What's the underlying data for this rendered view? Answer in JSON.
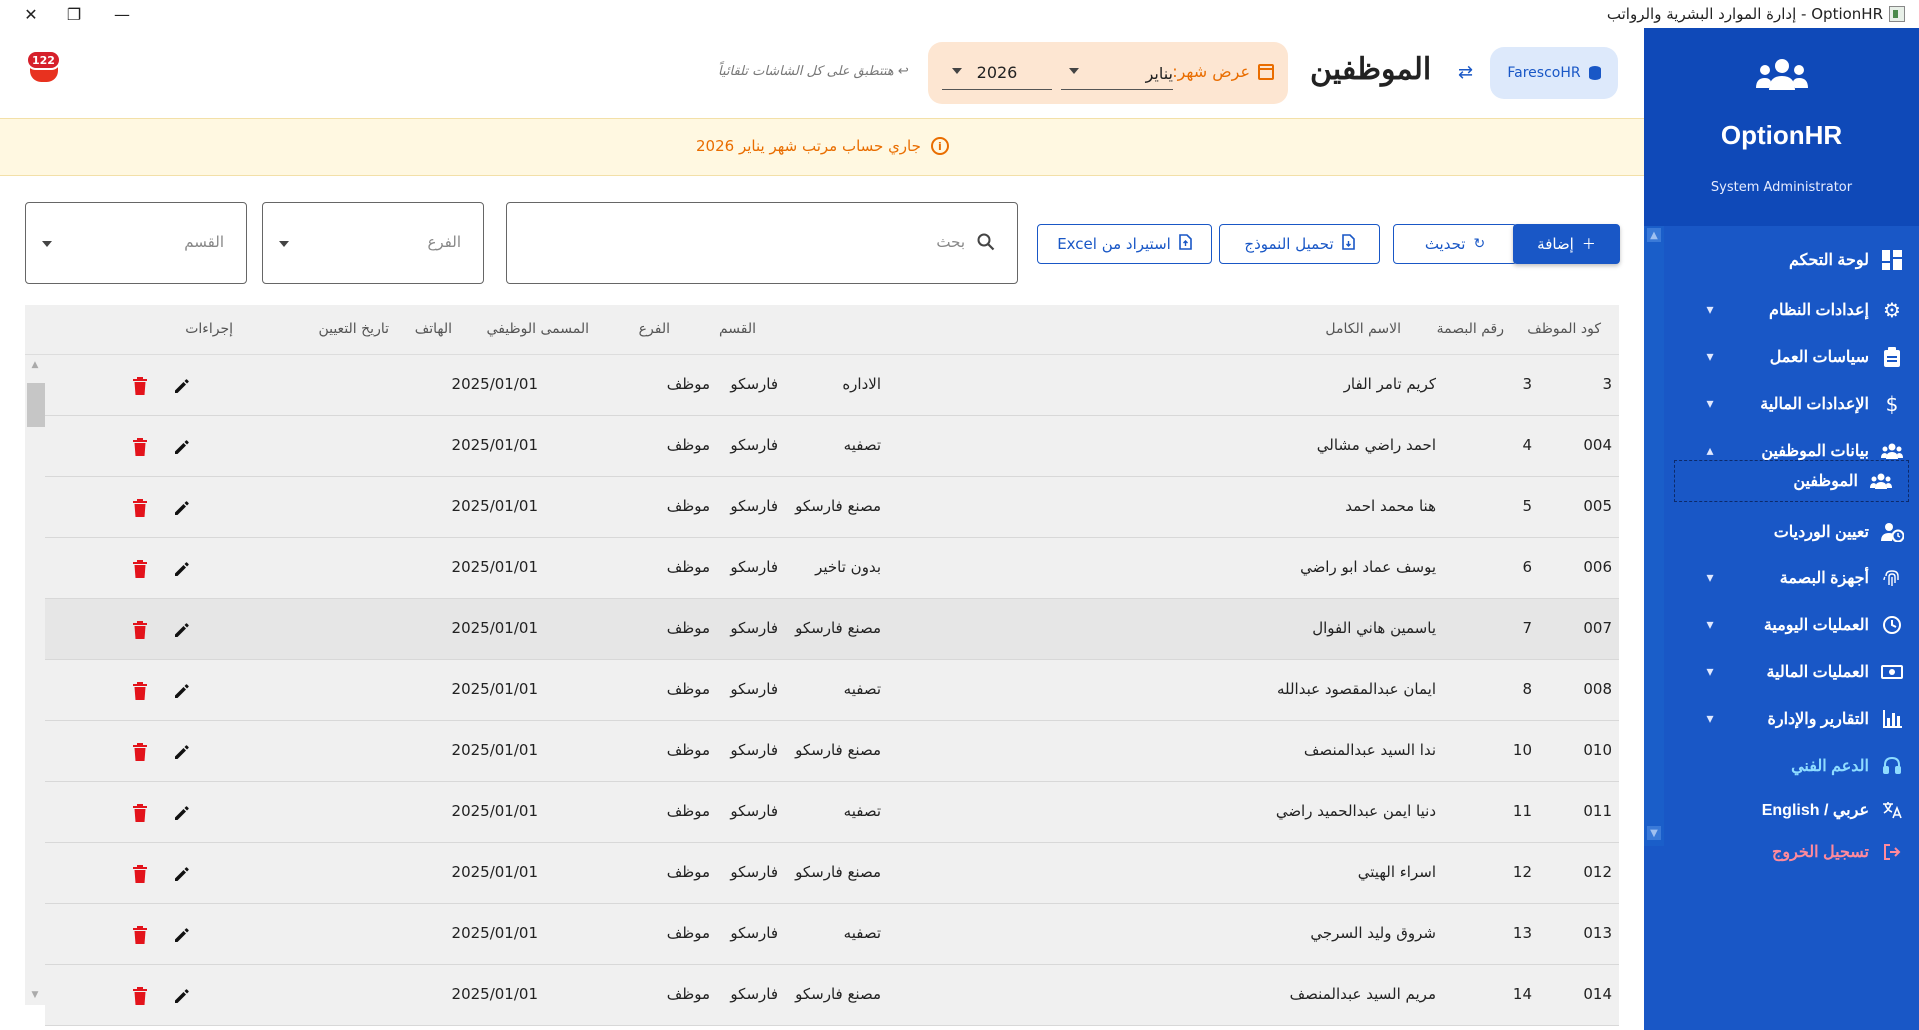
{
  "window": {
    "title": "OptionHR - إدارة الموارد البشرية والرواتب"
  },
  "sidebar": {
    "app_name": "OptionHR",
    "role": "System Administrator",
    "items": [
      {
        "label": "لوحة التحكم",
        "icon": "dashboard-icon"
      },
      {
        "label": "إعدادات النظام",
        "icon": "gear-icon"
      },
      {
        "label": "سياسات العمل",
        "icon": "clipboard-icon"
      },
      {
        "label": "الإعدادات المالية",
        "icon": "dollar-icon"
      },
      {
        "label": "بيانات الموظفين",
        "icon": "users-icon"
      },
      {
        "label": "الموظفين",
        "icon": "users-icon"
      },
      {
        "label": "تعيين الورديات",
        "icon": "user-clock-icon"
      },
      {
        "label": "أجهزة البصمة",
        "icon": "fingerprint-icon"
      },
      {
        "label": "العمليات اليومية",
        "icon": "clock-icon"
      },
      {
        "label": "العمليات المالية",
        "icon": "money-icon"
      },
      {
        "label": "التقارير والإدارة",
        "icon": "bar-chart-icon"
      },
      {
        "label": "الدعم الفني",
        "icon": "headset-icon"
      },
      {
        "label": "عربي / English",
        "icon": "translate-icon"
      },
      {
        "label": "تسجيل الخروج",
        "icon": "logout-icon"
      }
    ]
  },
  "header": {
    "notifications_count": "122",
    "hint": "↩ هتتطبق على كل الشاشات تلقائياً",
    "month_label": "عرض شهر:",
    "month_value": "يناير",
    "year_value": "2026",
    "page_title": "الموظفين",
    "database": "FarescoHR"
  },
  "banner": {
    "text": "جاري حساب مرتب شهر يناير 2026"
  },
  "filters": {
    "search_placeholder": "بحث",
    "branch_placeholder": "الفرع",
    "department_placeholder": "القسم"
  },
  "toolbar": {
    "add_label": "إضافة",
    "refresh_label": "تحديث",
    "template_label": "تحميل النموذج",
    "import_label": "استيراد من Excel"
  },
  "table": {
    "headers": {
      "code": "كود الموظف",
      "fingerprint": "رقم البصمة",
      "name": "الاسم الكامل",
      "department": "القسم",
      "branch": "الفرع",
      "job_title": "المسمى الوظيفي",
      "phone": "الهاتف",
      "hire_date": "تاريخ التعيين",
      "actions": "إجراءات"
    },
    "rows": [
      {
        "code": "3",
        "fingerprint": "3",
        "name": "كريم تامر الفار",
        "department": "الاداره",
        "branch": "فارسكو",
        "job_title": "موظف",
        "phone": "",
        "hire_date": "2025/01/01"
      },
      {
        "code": "004",
        "fingerprint": "4",
        "name": "احمد راضي مشالي",
        "department": "تصفيه",
        "branch": "فارسكو",
        "job_title": "موظف",
        "phone": "",
        "hire_date": "2025/01/01"
      },
      {
        "code": "005",
        "fingerprint": "5",
        "name": "هنا محمد احمد",
        "department": "مصنع فارسكو",
        "branch": "فارسكو",
        "job_title": "موظف",
        "phone": "",
        "hire_date": "2025/01/01"
      },
      {
        "code": "006",
        "fingerprint": "6",
        "name": "يوسف عماد ابو راضي",
        "department": "بدون تاخير",
        "branch": "فارسكو",
        "job_title": "موظف",
        "phone": "",
        "hire_date": "2025/01/01"
      },
      {
        "code": "007",
        "fingerprint": "7",
        "name": "ياسمين هاني الفوال",
        "department": "مصنع فارسكو",
        "branch": "فارسكو",
        "job_title": "موظف",
        "phone": "",
        "hire_date": "2025/01/01"
      },
      {
        "code": "008",
        "fingerprint": "8",
        "name": "ايمان عبدالمقصود عبدالله",
        "department": "تصفيه",
        "branch": "فارسكو",
        "job_title": "موظف",
        "phone": "",
        "hire_date": "2025/01/01"
      },
      {
        "code": "010",
        "fingerprint": "10",
        "name": "ندا السيد عبدالمنصف",
        "department": "مصنع فارسكو",
        "branch": "فارسكو",
        "job_title": "موظف",
        "phone": "",
        "hire_date": "2025/01/01"
      },
      {
        "code": "011",
        "fingerprint": "11",
        "name": "دنيا ايمن عبدالحميد راضي",
        "department": "تصفيه",
        "branch": "فارسكو",
        "job_title": "موظف",
        "phone": "",
        "hire_date": "2025/01/01"
      },
      {
        "code": "012",
        "fingerprint": "12",
        "name": "اسراء الهيتي",
        "department": "مصنع فارسكو",
        "branch": "فارسكو",
        "job_title": "موظف",
        "phone": "",
        "hire_date": "2025/01/01"
      },
      {
        "code": "013",
        "fingerprint": "13",
        "name": "شروق وليد السرجي",
        "department": "تصفيه",
        "branch": "فارسكو",
        "job_title": "موظف",
        "phone": "",
        "hire_date": "2025/01/01"
      },
      {
        "code": "014",
        "fingerprint": "14",
        "name": "مريم السيد عبدالمنصف",
        "department": "مصنع فارسكو",
        "branch": "فارسكو",
        "job_title": "موظف",
        "phone": "",
        "hire_date": "2025/01/01"
      }
    ]
  },
  "colors": {
    "primary": "#1957c6",
    "sidebar_header": "#0f49b8",
    "accent_orange": "#e96d00",
    "danger": "#e3131b"
  }
}
